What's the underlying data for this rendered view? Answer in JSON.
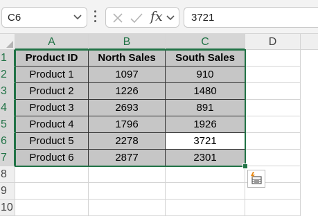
{
  "formula_bar": {
    "name_box": "C6",
    "formula": "3721",
    "fx_label": "fx"
  },
  "columns": [
    "A",
    "B",
    "C",
    "D"
  ],
  "rows": [
    "1",
    "2",
    "3",
    "4",
    "5",
    "6",
    "7",
    "8",
    "9",
    "10"
  ],
  "table": {
    "headers": [
      "Product ID",
      "North Sales",
      "South Sales"
    ],
    "rows": [
      [
        "Product 1",
        "1097",
        "910"
      ],
      [
        "Product 2",
        "1226",
        "1480"
      ],
      [
        "Product 3",
        "2693",
        "891"
      ],
      [
        "Product 4",
        "1796",
        "1926"
      ],
      [
        "Product 5",
        "2278",
        "3721"
      ],
      [
        "Product 6",
        "2877",
        "2301"
      ]
    ]
  },
  "active_cell": "C6",
  "colors": {
    "accent": "#217346",
    "table_fill": "#c6c6c6"
  }
}
